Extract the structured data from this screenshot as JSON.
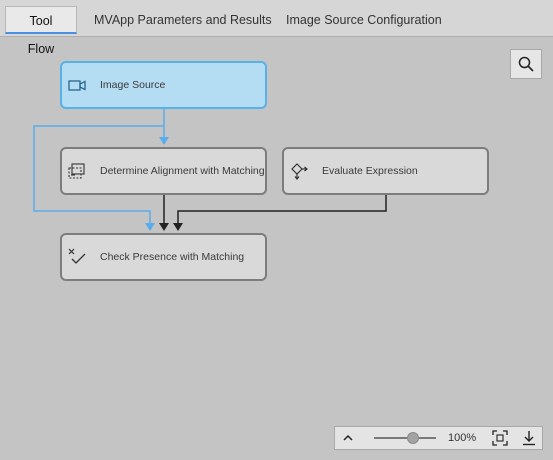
{
  "tabs": [
    {
      "label": "Tool Flow",
      "active": true
    },
    {
      "label": "MVApp Parameters and Results",
      "active": false
    },
    {
      "label": "Image Source Configuration",
      "active": false
    }
  ],
  "nodes": [
    {
      "label": "Image Source",
      "icon": "camera-icon",
      "selected": true
    },
    {
      "label": "Determine Alignment with Matching",
      "icon": "alignment-icon",
      "selected": false
    },
    {
      "label": "Evaluate Expression",
      "icon": "expression-icon",
      "selected": false
    },
    {
      "label": "Check Presence with Matching",
      "icon": "presence-check-icon",
      "selected": false
    }
  ],
  "zoom": {
    "percent_label": "100%",
    "slider_fraction": 0.65
  },
  "icons": {
    "search": "search-icon",
    "collapse": "chevron-up-icon",
    "fit": "fit-to-screen-icon",
    "download": "download-icon"
  },
  "colors": {
    "selected_fill": "#b4dcf3",
    "selected_border": "#56b2e8",
    "image_wire": "#5aacec",
    "data_wire": "#222222",
    "tab_underline": "#4a90e2"
  }
}
